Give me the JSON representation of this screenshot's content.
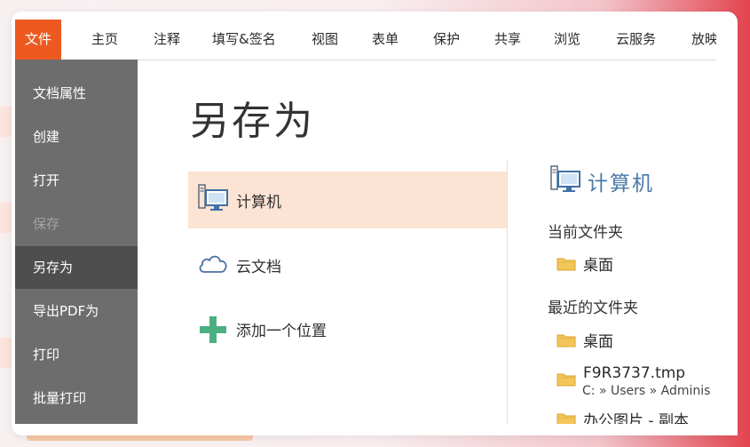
{
  "ribbon": {
    "tabs": [
      {
        "label": "文件",
        "active": true
      },
      {
        "label": "主页"
      },
      {
        "label": "注释"
      },
      {
        "label": "填写&签名"
      },
      {
        "label": "视图"
      },
      {
        "label": "表单"
      },
      {
        "label": "保护"
      },
      {
        "label": "共享"
      },
      {
        "label": "浏览"
      },
      {
        "label": "云服务"
      },
      {
        "label": "放映"
      }
    ]
  },
  "sidebar": {
    "items": [
      {
        "label": "文档属性"
      },
      {
        "label": "创建"
      },
      {
        "label": "打开"
      },
      {
        "label": "保存",
        "state": "disabled"
      },
      {
        "label": "另存为",
        "state": "selected"
      },
      {
        "label": "导出PDF为"
      },
      {
        "label": "打印"
      },
      {
        "label": "批量打印"
      }
    ]
  },
  "main": {
    "title": "另存为",
    "locations": [
      {
        "label": "计算机",
        "icon": "computer-icon",
        "selected": true
      },
      {
        "label": "云文档",
        "icon": "cloud-icon"
      },
      {
        "label": "添加一个位置",
        "icon": "plus-icon"
      }
    ]
  },
  "detail": {
    "title": "计算机",
    "current_folder_label": "当前文件夹",
    "current_folder": {
      "name": "桌面"
    },
    "recent_folders_label": "最近的文件夹",
    "recent_folders": [
      {
        "name": "桌面",
        "path": ""
      },
      {
        "name": "F9R3737.tmp",
        "path": "C: » Users » Adminis"
      },
      {
        "name": "办公图片 - 副本",
        "path": ""
      }
    ]
  },
  "colors": {
    "accent": "#ee5920",
    "sidebar_bg": "#6d6d6d",
    "sidebar_selected": "#4e4e4e",
    "selected_location": "#fde3d3",
    "detail_title": "#4b7aa7",
    "plus_green": "#4caf82",
    "folder_yellow": "#f3c65a"
  }
}
